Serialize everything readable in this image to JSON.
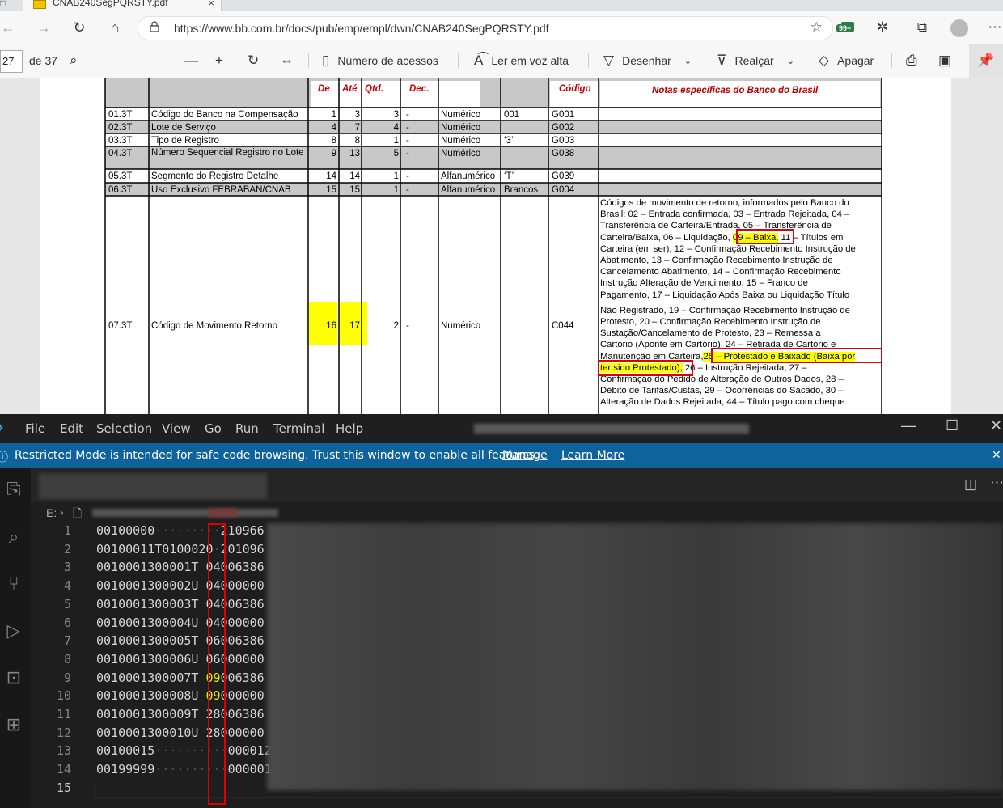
{
  "browser": {
    "tab_title": "CNAB240SegPQRSTY.pdf",
    "tab_close": "×",
    "url": "https://www.bb.com.br/docs/pub/emp/empl/dwn/CNAB240SegPQRSTY.pdf",
    "badge": "99+",
    "icons": [
      "back-icon",
      "forward-icon",
      "refresh-icon",
      "home-icon",
      "lock-icon",
      "favorite-icon",
      "extension-icon",
      "puzzle-icon",
      "collections-icon",
      "profile-icon",
      "more-icon"
    ]
  },
  "pdf_toolbar": {
    "page_current": "27",
    "page_total": "de 37",
    "access_numbers": "Número de acessos",
    "read_aloud": "Ler em voz alta",
    "draw": "Desenhar",
    "highlight": "Realçar",
    "erase": "Apagar"
  },
  "pdf_table": {
    "headers": {
      "de": "De",
      "ate": "Até",
      "qtd": "Qtd.",
      "dec": "Dec.",
      "codigo": "Código",
      "notas": "Notas específicas do Banco do Brasil"
    },
    "rows": [
      {
        "id": "01.3T",
        "desc": "Código do Banco na Compensação",
        "de": "1",
        "ate": "3",
        "qtd": "3",
        "dec": "-",
        "tipo": "Numérico",
        "default": "001",
        "code": "G001"
      },
      {
        "id": "02.3T",
        "desc": "Lote de Serviço",
        "de": "4",
        "ate": "7",
        "qtd": "4",
        "dec": "-",
        "tipo": "Numérico",
        "default": "",
        "code": "G002"
      },
      {
        "id": "03.3T",
        "desc": "Tipo de Registro",
        "de": "8",
        "ate": "8",
        "qtd": "1",
        "dec": "-",
        "tipo": "Numérico",
        "default": "‘3’",
        "code": "G003"
      },
      {
        "id": "04.3T",
        "desc": "Número Sequencial Registro no Lote",
        "de": "9",
        "ate": "13",
        "qtd": "5",
        "dec": "-",
        "tipo": "Numérico",
        "default": "",
        "code": "G038"
      },
      {
        "id": "05.3T",
        "desc": "Segmento do Registro Detalhe",
        "de": "14",
        "ate": "14",
        "qtd": "1",
        "dec": "-",
        "tipo": "Alfanumérico",
        "default": "‘T’",
        "code": "G039"
      },
      {
        "id": "06.3T",
        "desc": "Uso Exclusivo FEBRABAN/CNAB",
        "de": "15",
        "ate": "15",
        "qtd": "1",
        "dec": "-",
        "tipo": "Alfanumérico",
        "default": "Brancos",
        "code": "G004"
      },
      {
        "id": "07.3T",
        "desc": "Código de Movimento Retorno",
        "de": "16",
        "ate": "17",
        "qtd": "2",
        "dec": "-",
        "tipo": "Numérico",
        "default": "",
        "code": "C044"
      }
    ],
    "notes_lines": [
      "Códigos de movimento de retorno, informados pelo Banco do",
      "Brasil: 02 – Entrada confirmada, 03 – Entrada Rejeitada, 04 –",
      "Transferência de Carteira/Entrada, 05 – Transferência de",
      "Carteira/Baixa, 06 – Liquidação,",
      "09 – Baixa,",
      " 11 – Títulos em",
      "Carteira (em ser), 12 – Confirmação Recebimento Instrução de",
      "Abatimento, 13 – Confirmação Recebimento Instrução de",
      "Cancelamento Abatimento, 14 – Confirmação Recebimento",
      "Instrução Alteração de Vencimento, 15 – Franco de",
      "Pagamento, 17 – Liquidação Após Baixa ou Liquidação Título",
      "Não Registrado, 19 – Confirmação Recebimento Instrução de",
      "Protesto, 20 – Confirmação Recebimento Instrução de",
      "Sustação/Cancelamento de Protesto, 23 – Remessa a",
      "Cartório (Aponte em Cartório), 24 – Retirada de Cartório e",
      "Manutenção em Carteira,",
      "25 – Protestado e Baixado (Baixa por",
      "ter sido Protestado),",
      " 26 – Instrução Rejeitada, 27 –",
      "Confirmação do Pedido de Alteração de Outros Dados, 28 –",
      "Débito de Tarifas/Custas, 29 – Ocorrências do Sacado, 30 –",
      "Alteração de Dados Rejeitada, 44 – Título pago com cheque"
    ]
  },
  "vscode": {
    "menu": [
      "File",
      "Edit",
      "Selection",
      "View",
      "Go",
      "Run",
      "Terminal",
      "Help"
    ],
    "restricted_text": "Restricted Mode is intended for safe code browsing. Trust this window to enable all features.",
    "manage": "Manage",
    "learn_more": "Learn More",
    "breadcrumb_drive": "E:",
    "lines": [
      {
        "n": "1",
        "a": "00100000",
        "g": "·········",
        "b": "210966"
      },
      {
        "n": "2",
        "a": "00100011T0100020",
        "g": "·",
        "b": "201096"
      },
      {
        "n": "3",
        "a": "0010001300001T",
        "g": " ",
        "h": "04",
        "b": "006386"
      },
      {
        "n": "4",
        "a": "0010001300002U",
        "g": " ",
        "h": "04",
        "b": "000000"
      },
      {
        "n": "5",
        "a": "0010001300003T",
        "g": " ",
        "h": "04",
        "b": "006386"
      },
      {
        "n": "6",
        "a": "0010001300004U",
        "g": " ",
        "h": "04",
        "b": "000000"
      },
      {
        "n": "7",
        "a": "0010001300005T",
        "g": " ",
        "h": "06",
        "b": "006386"
      },
      {
        "n": "8",
        "a": "0010001300006U",
        "g": " ",
        "h": "06",
        "b": "000000"
      },
      {
        "n": "9",
        "a": "0010001300007T",
        "g": " ",
        "h": "09",
        "b": "006386",
        "yellow": true
      },
      {
        "n": "10",
        "a": "0010001300008U",
        "g": " ",
        "h": "09",
        "b": "000000",
        "yellow": true
      },
      {
        "n": "11",
        "a": "0010001300009T",
        "g": " ",
        "h": "28",
        "b": "006386"
      },
      {
        "n": "12",
        "a": "0010001300010U",
        "g": " ",
        "h": "28",
        "b": "000000"
      },
      {
        "n": "13",
        "a": "00100015",
        "g": "··········",
        "b": "000012"
      },
      {
        "n": "14",
        "a": "00199999",
        "g": "··········",
        "b": "000001"
      },
      {
        "n": "15",
        "a": "",
        "g": "",
        "b": ""
      }
    ]
  },
  "colors": {
    "highlight": "#ffff00",
    "annotation_red": "#e00000",
    "vscode_blue": "#0e639c"
  }
}
